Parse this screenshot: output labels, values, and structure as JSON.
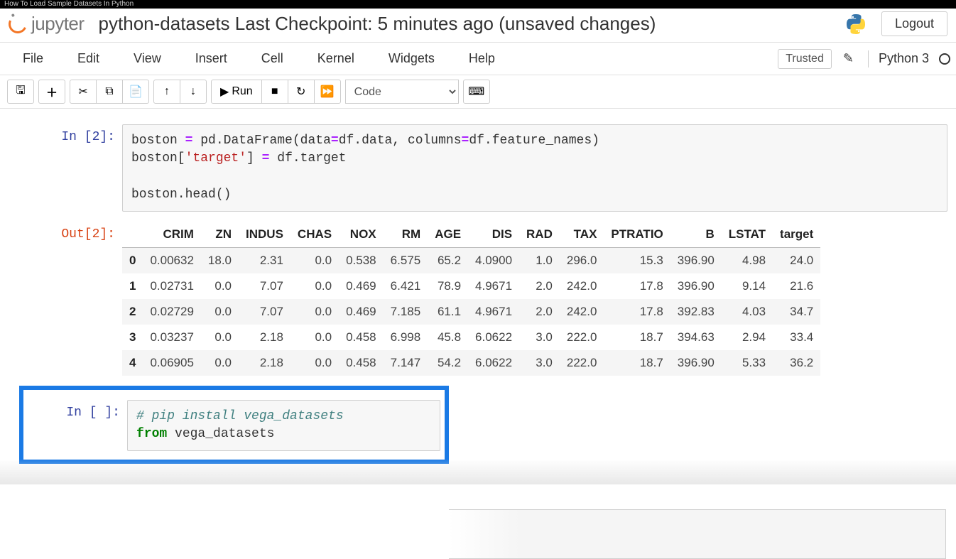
{
  "window_title": "How To Load Sample Datasets In Python",
  "logo_text": "jupyter",
  "notebook_title": "python-datasets Last Checkpoint: 5 minutes ago  (unsaved changes)",
  "logout": "Logout",
  "menu": {
    "file": "File",
    "edit": "Edit",
    "view": "View",
    "insert": "Insert",
    "cell": "Cell",
    "kernel": "Kernel",
    "widgets": "Widgets",
    "help": "Help"
  },
  "trusted": "Trusted",
  "kernel_name": "Python 3",
  "toolbar": {
    "run": "Run",
    "celltype": "Code"
  },
  "cells": {
    "in2_prompt": "In [2]:",
    "in2_line1a": "boston ",
    "in2_line1b": "= pd.DataFrame(data=df.data, columns=df.feature_names)",
    "in2_line2a": "boston[",
    "in2_line2b": "'target'",
    "in2_line2c": "] = df.target",
    "in2_line3": "",
    "in2_line4": "boston.head()",
    "out2_prompt": "Out[2]:",
    "in3_prompt": "In [ ]:",
    "in3_line1": "# pip install vega_datasets",
    "in3_line2a": "from",
    "in3_line2b": " vega_datasets"
  },
  "chart_data": {
    "type": "table",
    "columns": [
      "CRIM",
      "ZN",
      "INDUS",
      "CHAS",
      "NOX",
      "RM",
      "AGE",
      "DIS",
      "RAD",
      "TAX",
      "PTRATIO",
      "B",
      "LSTAT",
      "target"
    ],
    "index": [
      "0",
      "1",
      "2",
      "3",
      "4"
    ],
    "rows": [
      [
        "0.00632",
        "18.0",
        "2.31",
        "0.0",
        "0.538",
        "6.575",
        "65.2",
        "4.0900",
        "1.0",
        "296.0",
        "15.3",
        "396.90",
        "4.98",
        "24.0"
      ],
      [
        "0.02731",
        "0.0",
        "7.07",
        "0.0",
        "0.469",
        "6.421",
        "78.9",
        "4.9671",
        "2.0",
        "242.0",
        "17.8",
        "396.90",
        "9.14",
        "21.6"
      ],
      [
        "0.02729",
        "0.0",
        "7.07",
        "0.0",
        "0.469",
        "7.185",
        "61.1",
        "4.9671",
        "2.0",
        "242.0",
        "17.8",
        "392.83",
        "4.03",
        "34.7"
      ],
      [
        "0.03237",
        "0.0",
        "2.18",
        "0.0",
        "0.458",
        "6.998",
        "45.8",
        "6.0622",
        "3.0",
        "222.0",
        "18.7",
        "394.63",
        "2.94",
        "33.4"
      ],
      [
        "0.06905",
        "0.0",
        "2.18",
        "0.0",
        "0.458",
        "7.147",
        "54.2",
        "6.0622",
        "3.0",
        "222.0",
        "18.7",
        "396.90",
        "5.33",
        "36.2"
      ]
    ]
  }
}
